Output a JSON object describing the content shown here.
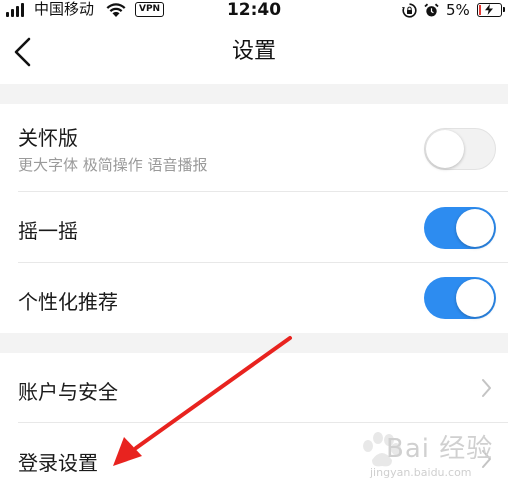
{
  "status_bar": {
    "carrier": "中国移动",
    "vpn_label": "VPN",
    "time": "12:40",
    "battery_percent": "5%",
    "battery_level": 0.05,
    "icons": [
      "signal-icon",
      "wifi-icon",
      "rotation-lock-icon",
      "alarm-icon",
      "battery-icon"
    ]
  },
  "nav": {
    "title": "设置",
    "back_icon": "chevron-left-icon"
  },
  "settings": {
    "care_mode": {
      "label": "关怀版",
      "subtitle": "更大字体 极简操作 语音播报",
      "enabled": false
    },
    "shake": {
      "label": "摇一摇",
      "enabled": true
    },
    "personalized": {
      "label": "个性化推荐",
      "enabled": true
    },
    "account_security": {
      "label": "账户与安全"
    },
    "login_settings": {
      "label": "登录设置"
    }
  },
  "watermark": {
    "text": "Bai 经验",
    "sub": "jingyan.baidu.com"
  },
  "colors": {
    "accent": "#2d8cf0",
    "annotation_arrow": "#e8231f",
    "section_gap": "#f3f3f3"
  }
}
